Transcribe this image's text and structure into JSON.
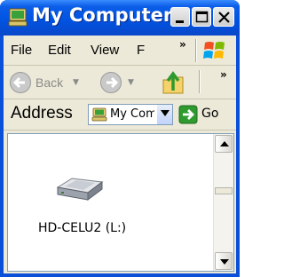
{
  "window": {
    "title": "My Computer",
    "accent": "#0054e3"
  },
  "menubar": {
    "items": [
      "File",
      "Edit",
      "View",
      "F"
    ],
    "overflow": "»"
  },
  "toolbar": {
    "back_label": "Back",
    "overflow": "»"
  },
  "addressbar": {
    "label": "Address",
    "value": "My Computer",
    "go_label": "Go"
  },
  "content": {
    "items": [
      {
        "label": "HD-CELU2 (L:)",
        "icon": "hard-drive-icon"
      }
    ]
  }
}
